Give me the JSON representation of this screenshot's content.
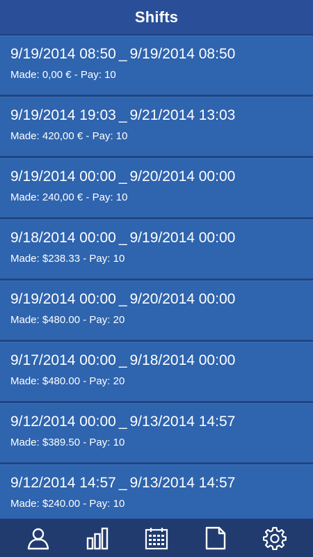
{
  "header": {
    "title": "Shifts"
  },
  "shifts": [
    {
      "start": "9/19/2014 08:50",
      "end": "9/19/2014 08:50",
      "made": "Made: 0,00 €",
      "pay": "Pay: 10"
    },
    {
      "start": "9/19/2014 19:03",
      "end": "9/21/2014 13:03",
      "made": "Made: 420,00 €",
      "pay": "Pay: 10"
    },
    {
      "start": "9/19/2014 00:00",
      "end": "9/20/2014 00:00",
      "made": "Made: 240,00 €",
      "pay": "Pay: 10"
    },
    {
      "start": "9/18/2014 00:00",
      "end": "9/19/2014 00:00",
      "made": "Made: $238.33",
      "pay": "Pay: 10"
    },
    {
      "start": "9/19/2014 00:00",
      "end": "9/20/2014 00:00",
      "made": "Made: $480.00",
      "pay": "Pay: 20"
    },
    {
      "start": "9/17/2014 00:00",
      "end": "9/18/2014 00:00",
      "made": "Made: $480.00",
      "pay": "Pay: 20"
    },
    {
      "start": "9/12/2014 00:00",
      "end": "9/13/2014 14:57",
      "made": "Made: $389.50",
      "pay": "Pay: 10"
    },
    {
      "start": "9/12/2014 14:57",
      "end": "9/13/2014 14:57",
      "made": "Made: $240.00",
      "pay": "Pay: 10"
    }
  ],
  "separators": {
    "range": "_",
    "detail": "-"
  },
  "bottom_nav": [
    {
      "icon": "user-icon"
    },
    {
      "icon": "bar-chart-icon"
    },
    {
      "icon": "calendar-icon"
    },
    {
      "icon": "document-icon"
    },
    {
      "icon": "gear-icon"
    }
  ],
  "colors": {
    "header_bg": "#2a4f98",
    "row_bg": "#2f64ae",
    "nav_bg": "#213b6f",
    "text": "#ffffff"
  }
}
